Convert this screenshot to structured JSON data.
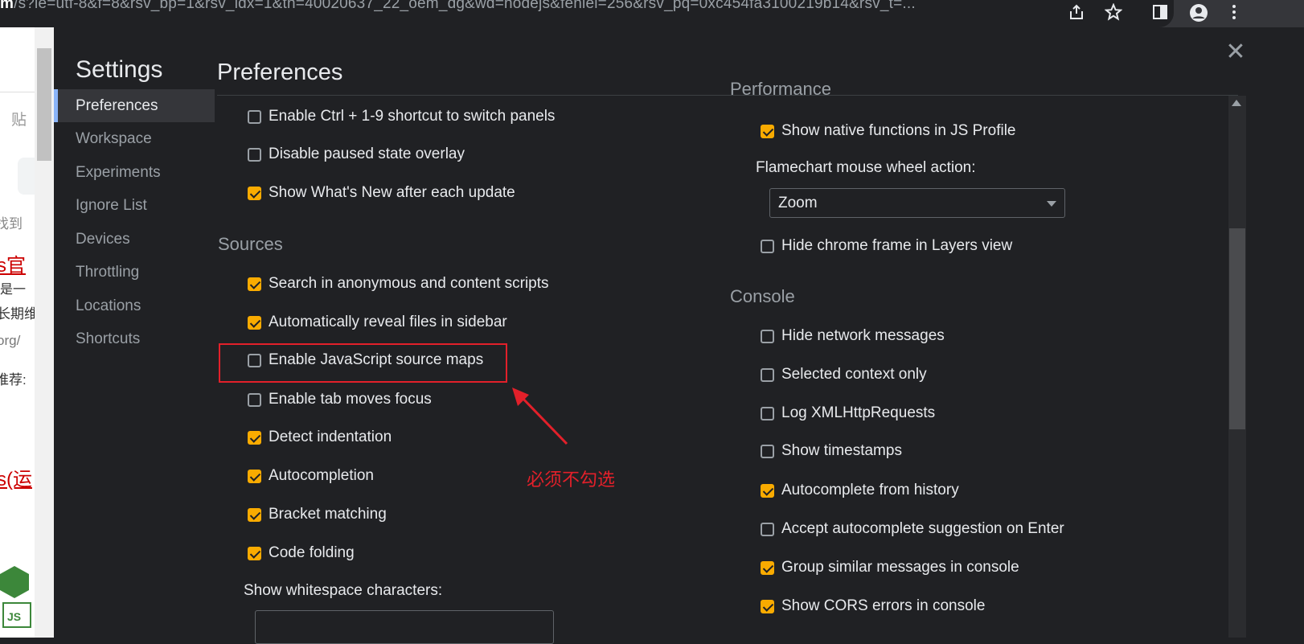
{
  "browser": {
    "url_prefix": "m",
    "url_rest": "/s?ie=utf-8&f=8&rsv_bp=1&rsv_idx=1&tn=40020637_22_oem_dg&wd=nodejs&fenlei=256&rsv_pq=0xc454fa3100219b14&rsv_t=...",
    "icons": [
      "share-icon",
      "star-icon",
      "sidepanel-icon",
      "profile-icon",
      "menu-icon"
    ]
  },
  "background_page": {
    "snippets": [
      "贴",
      "找到",
      "s官",
      "是一",
      "长期维",
      "org/",
      "推荐:",
      "s(运"
    ]
  },
  "settings": {
    "title": "Settings",
    "nav": [
      "Preferences",
      "Workspace",
      "Experiments",
      "Ignore List",
      "Devices",
      "Throttling",
      "Locations",
      "Shortcuts"
    ],
    "active_nav": "Preferences",
    "page_title": "Preferences",
    "left_column": {
      "top_items": [
        {
          "label": "Enable Ctrl + 1-9 shortcut to switch panels",
          "checked": false
        },
        {
          "label": "Disable paused state overlay",
          "checked": false
        },
        {
          "label": "Show What's New after each update",
          "checked": true
        }
      ],
      "sources_title": "Sources",
      "sources_items": [
        {
          "label": "Search in anonymous and content scripts",
          "checked": true
        },
        {
          "label": "Automatically reveal files in sidebar",
          "checked": true
        },
        {
          "label": "Enable JavaScript source maps",
          "checked": false
        },
        {
          "label": "Enable tab moves focus",
          "checked": false
        },
        {
          "label": "Detect indentation",
          "checked": true
        },
        {
          "label": "Autocompletion",
          "checked": true
        },
        {
          "label": "Bracket matching",
          "checked": true
        },
        {
          "label": "Code folding",
          "checked": true
        }
      ],
      "whitespace_label": "Show whitespace characters:"
    },
    "right_column": {
      "performance_title": "Performance",
      "performance_items": [
        {
          "label": "Show native functions in JS Profile",
          "checked": true
        }
      ],
      "flamechart_label": "Flamechart mouse wheel action:",
      "flamechart_value": "Zoom",
      "layers_item": {
        "label": "Hide chrome frame in Layers view",
        "checked": false
      },
      "console_title": "Console",
      "console_items": [
        {
          "label": "Hide network messages",
          "checked": false
        },
        {
          "label": "Selected context only",
          "checked": false
        },
        {
          "label": "Log XMLHttpRequests",
          "checked": false
        },
        {
          "label": "Show timestamps",
          "checked": false
        },
        {
          "label": "Autocomplete from history",
          "checked": true
        },
        {
          "label": "Accept autocomplete suggestion on Enter",
          "checked": false
        },
        {
          "label": "Group similar messages in console",
          "checked": true
        },
        {
          "label": "Show CORS errors in console",
          "checked": true
        }
      ]
    }
  },
  "annotation": {
    "text": "必须不勾选",
    "color": "#e2202a"
  },
  "colors": {
    "checkbox_checked": "#f9ab00",
    "panel_bg": "#202124",
    "highlight": "#e2202a"
  }
}
